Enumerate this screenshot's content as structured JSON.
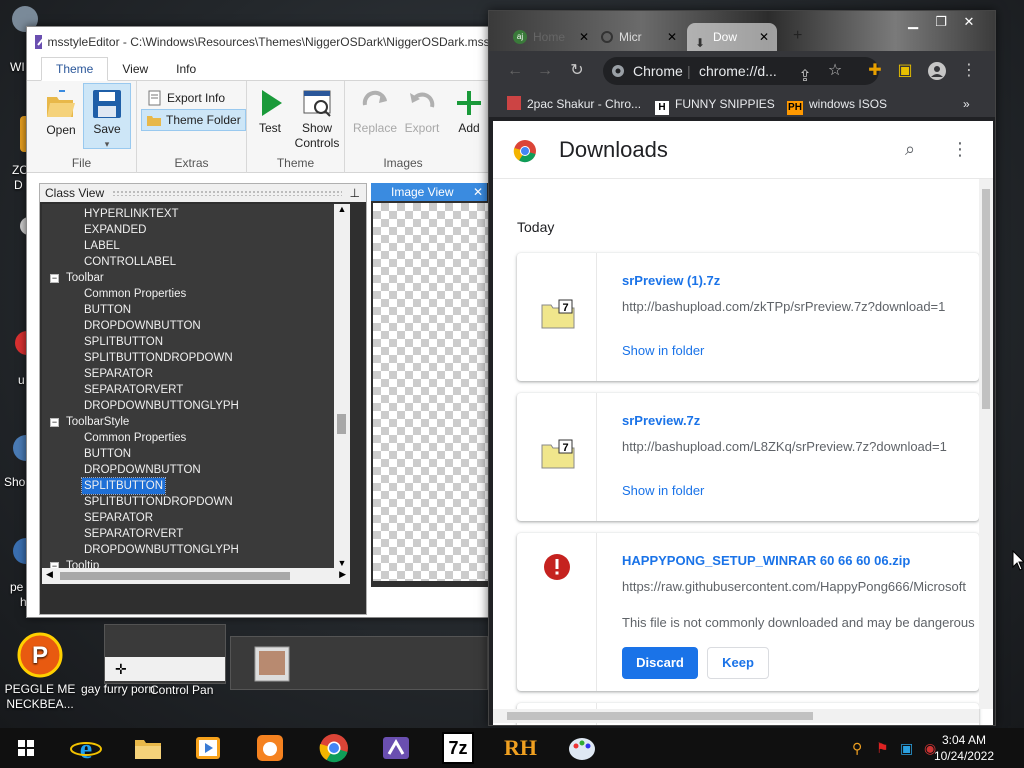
{
  "desktop": {
    "icons": [
      {
        "label": "PEGGLE ME NECKBEA...",
        "icon": "peggle-icon"
      },
      {
        "label": "gay furry porn",
        "icon": "green-app-icon"
      },
      {
        "label": "Control Pan",
        "icon": "control-panel-icon"
      }
    ],
    "partial_labels": [
      "WI",
      "ZO",
      "D",
      "u",
      "Sho",
      "pe",
      "h"
    ]
  },
  "mse": {
    "title": "msstyleEditor - C:\\Windows\\Resources\\Themes\\NiggerOSDark\\NiggerOSDark.msst",
    "tabs": [
      "Theme",
      "View",
      "Info"
    ],
    "active_tab": "Theme",
    "groups": {
      "file": {
        "name": "File",
        "open": "Open",
        "save": "Save"
      },
      "extras": {
        "name": "Extras",
        "export_info": "Export Info",
        "theme_folder": "Theme Folder"
      },
      "theme": {
        "name": "Theme",
        "test": "Test",
        "show_controls": "Show Controls"
      },
      "images": {
        "name": "Images",
        "replace": "Replace",
        "export": "Export",
        "add": "Add"
      }
    },
    "class_view": {
      "title": "Class View",
      "tree": [
        {
          "label": "HYPERLINKTEXT",
          "level": 2
        },
        {
          "label": "EXPANDED",
          "level": 2
        },
        {
          "label": "LABEL",
          "level": 2
        },
        {
          "label": "CONTROLLABEL",
          "level": 2
        },
        {
          "label": "Toolbar",
          "level": 1
        },
        {
          "label": "Common Properties",
          "level": 2
        },
        {
          "label": "BUTTON",
          "level": 2
        },
        {
          "label": "DROPDOWNBUTTON",
          "level": 2
        },
        {
          "label": "SPLITBUTTON",
          "level": 2
        },
        {
          "label": "SPLITBUTTONDROPDOWN",
          "level": 2
        },
        {
          "label": "SEPARATOR",
          "level": 2
        },
        {
          "label": "SEPARATORVERT",
          "level": 2
        },
        {
          "label": "DROPDOWNBUTTONGLYPH",
          "level": 2
        },
        {
          "label": "ToolbarStyle",
          "level": 1
        },
        {
          "label": "Common Properties",
          "level": 2
        },
        {
          "label": "BUTTON",
          "level": 2
        },
        {
          "label": "DROPDOWNBUTTON",
          "level": 2
        },
        {
          "label": "SPLITBUTTON",
          "level": 2,
          "selected": true
        },
        {
          "label": "SPLITBUTTONDROPDOWN",
          "level": 2
        },
        {
          "label": "SEPARATOR",
          "level": 2
        },
        {
          "label": "SEPARATORVERT",
          "level": 2
        },
        {
          "label": "DROPDOWNBUTTONGLYPH",
          "level": 2
        },
        {
          "label": "Tooltip",
          "level": 1
        }
      ]
    },
    "image_view": {
      "title": "Image View"
    }
  },
  "chrome": {
    "tabs": [
      {
        "label": "Home",
        "favicon": "aj"
      },
      {
        "label": "Micr"
      },
      {
        "label": "Dow",
        "active": true
      }
    ],
    "omnibox": {
      "site": "Chrome",
      "url": "chrome://d..."
    },
    "bookmarks": [
      {
        "label": "2pac Shakur - Chro...",
        "badge": ""
      },
      {
        "label": "FUNNY SNIPPIES",
        "badge": "H"
      },
      {
        "label": "windows ISOS",
        "badge": "PH"
      }
    ],
    "downloads": {
      "title": "Downloads",
      "section": "Today",
      "items": [
        {
          "name": "srPreview (1).7z",
          "url": "http://bashupload.com/zkTPp/srPreview.7z?download=1",
          "action": "Show in folder",
          "icon": "7z-file-icon"
        },
        {
          "name": "srPreview.7z",
          "url": "http://bashupload.com/L8ZKq/srPreview.7z?download=1",
          "action": "Show in folder",
          "icon": "7z-file-icon"
        },
        {
          "name": "HAPPYPONG_SETUP_WINRAR 60 66 60 06.zip",
          "url": "https://raw.githubusercontent.com/HappyPong666/Microsoft",
          "warning": "This file is not commonly downloaded and may be dangerous",
          "discard": "Discard",
          "keep": "Keep",
          "icon": "warning-icon"
        }
      ]
    }
  },
  "taskbar": {
    "time": "3:04 AM",
    "date": "10/24/2022",
    "apps": [
      "windows-start-icon",
      "internet-explorer-icon",
      "file-explorer-icon",
      "media-player-icon",
      "uc-browser-icon",
      "chrome-icon",
      "visual-studio-icon",
      "7zip-icon",
      "rh-icon",
      "paint-icon"
    ],
    "rh_label": "RH",
    "sevenzip_label": "7z"
  },
  "colors": {
    "accent": "#1a73e8",
    "selection": "#1e6fd6",
    "taskbar": "#101010"
  }
}
